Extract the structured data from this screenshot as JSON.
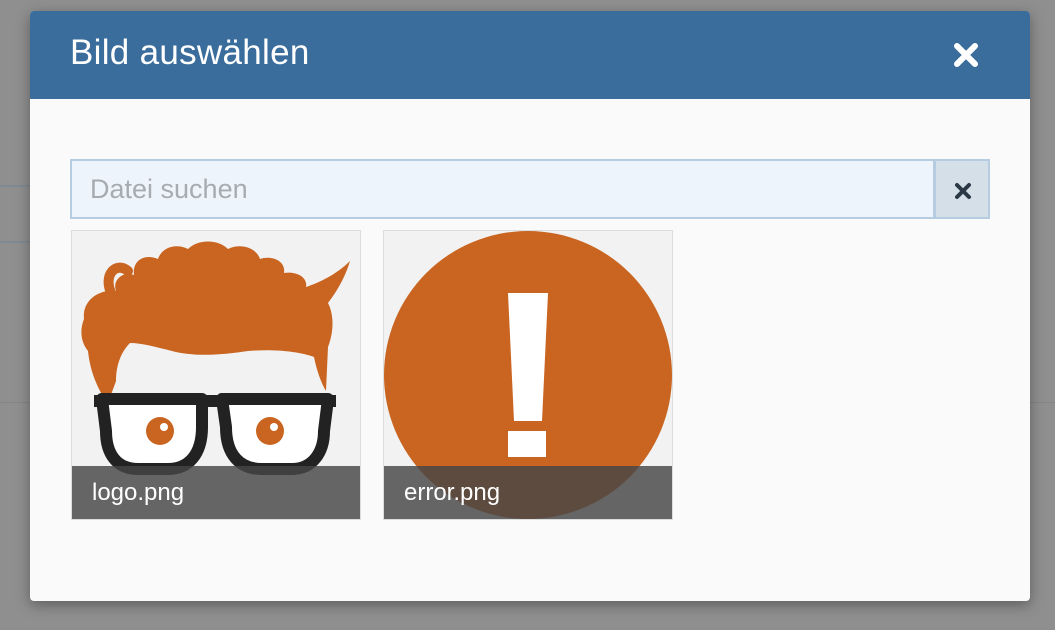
{
  "dialog": {
    "title": "Bild auswählen",
    "close_icon": "close-icon"
  },
  "search": {
    "placeholder": "Datei suchen",
    "value": "",
    "clear_icon": "close-icon"
  },
  "files": [
    {
      "name": "logo.png",
      "thumbnail": "cartoon-face-with-glasses"
    },
    {
      "name": "error.png",
      "thumbnail": "exclamation-circle"
    }
  ],
  "colors": {
    "header": "#3a6d9c",
    "accent_orange": "#c96521",
    "overlay": "#464646"
  }
}
